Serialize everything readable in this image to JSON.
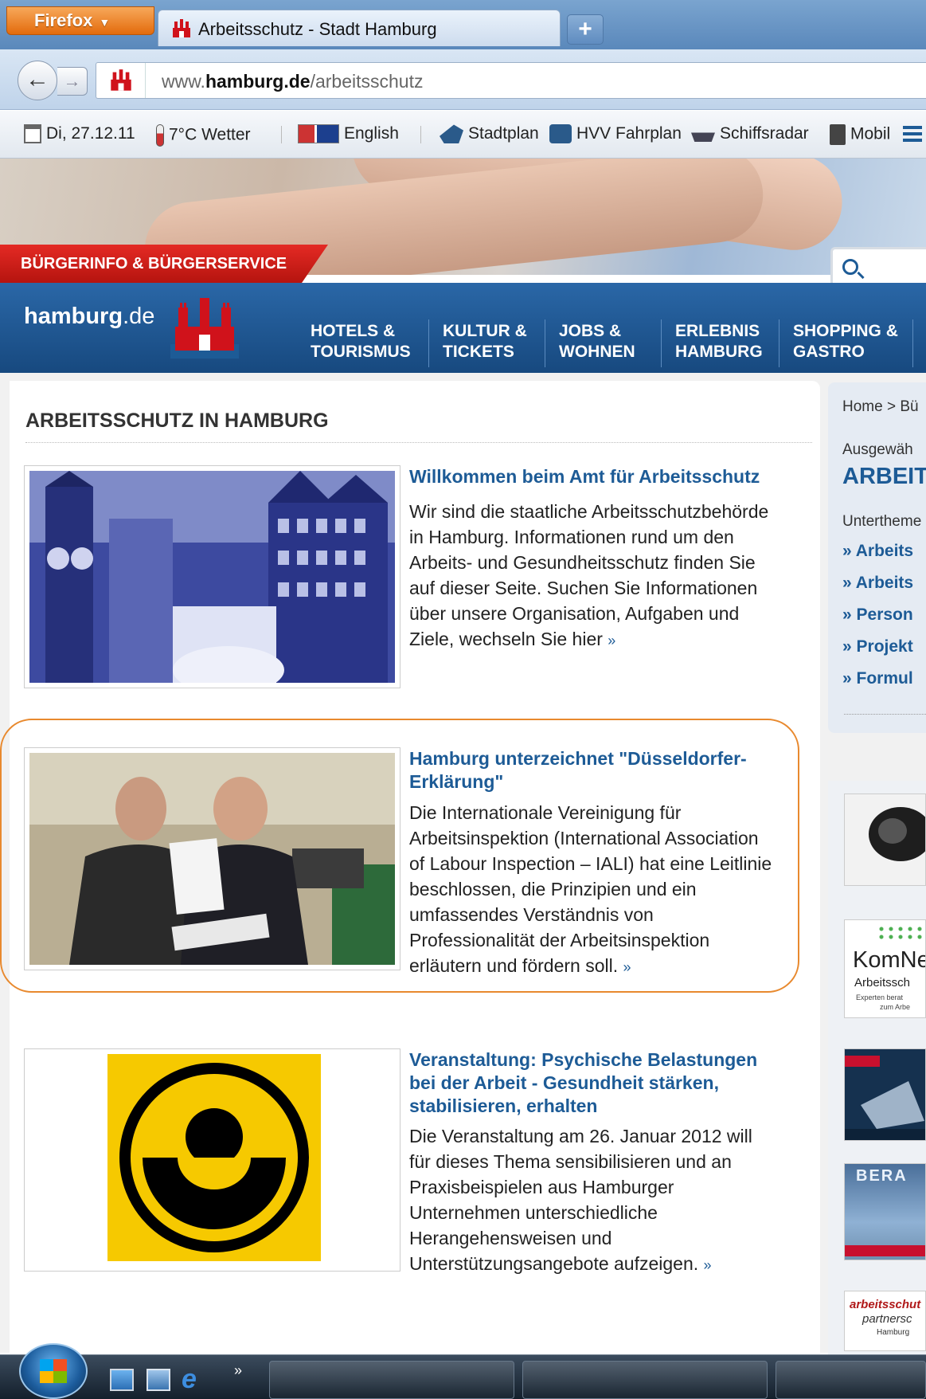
{
  "browser": {
    "firefox_button": "Firefox",
    "tab_title": "Arbeitsschutz - Stadt Hamburg",
    "new_tab": "+",
    "url_prefix": "www.",
    "url_domain": "hamburg.de",
    "url_path": "/arbeitsschutz"
  },
  "bookmarks": {
    "date": "Di, 27.12.11",
    "weather": "7°C Wetter",
    "english": "English",
    "stadtplan": "Stadtplan",
    "hvv": "HVV Fahrplan",
    "schiffsradar": "Schiffsradar",
    "mobil": "Mobil"
  },
  "header": {
    "buergerinfo": "BÜRGERINFO & BÜRGERSERVICE",
    "logo_main": "hamburg",
    "logo_tld": ".de"
  },
  "nav": [
    {
      "line1": "HOTELS &",
      "line2": "TOURISMUS"
    },
    {
      "line1": "KULTUR &",
      "line2": "TICKETS"
    },
    {
      "line1": "JOBS &",
      "line2": "WOHNEN"
    },
    {
      "line1": "ERLEBNIS",
      "line2": "HAMBURG"
    },
    {
      "line1": "SHOPPING &",
      "line2": "GASTRO"
    }
  ],
  "page_title": "ARBEITSSCHUTZ IN HAMBURG",
  "articles": [
    {
      "title_lines": [
        "Willkommen beim Amt für Arbeitsschutz"
      ],
      "text_lines": [
        "Wir sind die staatliche Arbeitsschutzbehörde",
        "in Hamburg. Informationen rund um den",
        "Arbeits- und Gesundheitsschutz finden Sie",
        "auf dieser Seite. Suchen Sie Informationen",
        "über unsere Organisation, Aufgaben und",
        "Ziele, wechseln Sie hier"
      ],
      "more": "»"
    },
    {
      "title_lines": [
        "Hamburg unterzeichnet \"Düsseldorfer-",
        "Erklärung\""
      ],
      "text_lines": [
        "Die Internationale Vereinigung  für",
        "Arbeitsinspektion (International Association",
        "of Labour Inspection – IALI) hat eine Leitlinie",
        "beschlossen, die Prinzipien und ein",
        "umfassendes Verständnis von",
        "Professionalität der Arbeitsinspektion",
        "erläutern und fördern soll."
      ],
      "more": "»"
    },
    {
      "title_lines": [
        "Veranstaltung: Psychische Belastungen",
        "bei der Arbeit - Gesundheit stärken,",
        "stabilisieren, erhalten"
      ],
      "text_lines": [
        "Die Veranstaltung am 26. Januar 2012 will",
        "für dieses Thema sensibilisieren und an",
        "Praxisbeispielen aus Hamburger",
        "Unternehmen unterschiedliche",
        "Herangehensweisen und",
        "Unterstützungsangebote aufzeigen."
      ],
      "more": "»"
    }
  ],
  "sidebar": {
    "breadcrumb": "Home > Bü",
    "ausgewaehlt": "Ausgewäh",
    "heading": "ARBEIT",
    "unterthemen": "Untertheme",
    "links": [
      "» Arbeits",
      "» Arbeits",
      "» Person",
      "» Projekt",
      "» Formul"
    ],
    "komnet_title": "KomNe",
    "komnet_sub": "Arbeitssch",
    "komnet_small": "Experten berat",
    "komnet_small2": "zum Arbe",
    "arbeit_box_label": "BERA",
    "partner_line1": "arbeitsschut",
    "partner_line2": "partnersc",
    "partner_line3": "Hamburg"
  },
  "taskbar": {
    "overflow": "»"
  }
}
